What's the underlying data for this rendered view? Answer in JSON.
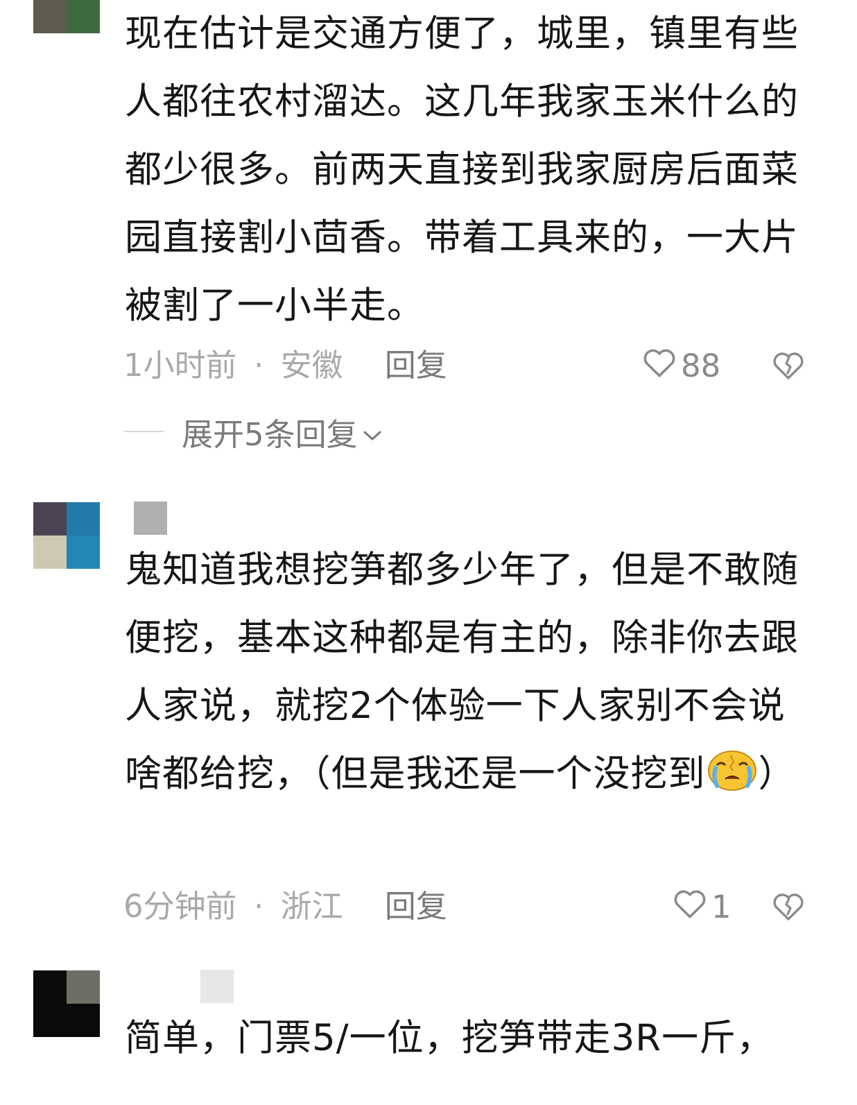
{
  "comments": [
    {
      "text": "现在估计是交通方便了，城里，镇里有些人都往农村溜达。这几年我家玉米什么的都少很多。前两天直接到我家厨房后面菜园直接割小茴香。带着工具来的，一大片被割了一小半走。",
      "time": "1小时前",
      "location": "安徽",
      "reply_label": "回复",
      "likes": "88",
      "expand_label": "展开5条回复"
    },
    {
      "text_before_emoji": "鬼知道我想挖笋都多少年了，但是不敢随便挖，基本这种都是有主的，除非你去跟人家说，就挖2个体验一下人家别不会说啥都给挖，（但是我还是一个没挖到",
      "text_after_emoji": "）",
      "emoji": "crying-face-emoji",
      "time": "6分钟前",
      "location": "浙江",
      "reply_label": "回复",
      "likes": "1"
    },
    {
      "text": "简单，门票5/一位，挖笋带走3R一斤，"
    }
  ],
  "separator": "·",
  "icons": {
    "like": "heart-outline-icon",
    "dislike": "broken-heart-icon",
    "expand": "chevron-down-icon"
  },
  "colors": {
    "text": "#161616",
    "meta": "#a9a9a9",
    "reply": "#7a7a7a"
  }
}
